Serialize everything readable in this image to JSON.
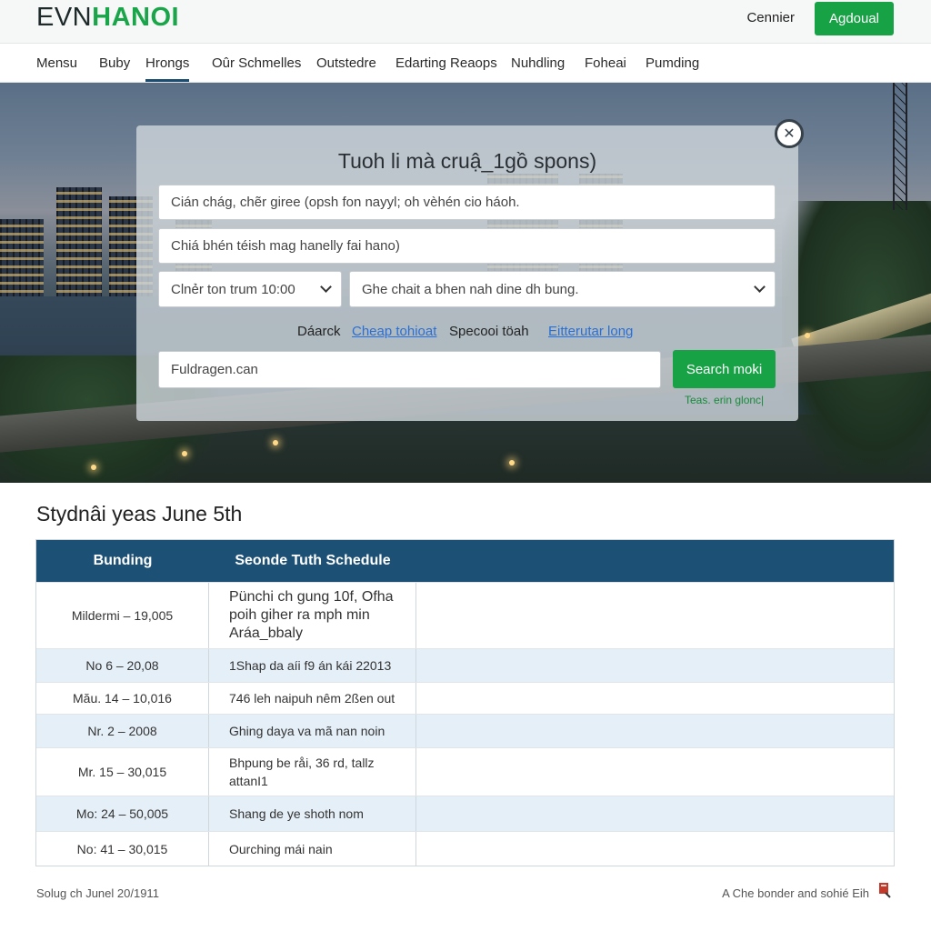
{
  "header": {
    "logo_part1": "EVN",
    "logo_part2": "HANOI",
    "signin_label": "Cennier",
    "primary_button_label": "Agdoual"
  },
  "nav": {
    "items": [
      {
        "label": "Mensu"
      },
      {
        "label": "Buby"
      },
      {
        "label": "Hrongs"
      },
      {
        "label": "Oûr Schmelles"
      },
      {
        "label": "Outstedre"
      },
      {
        "label": "Edarting Reaops"
      },
      {
        "label": "Nuhdling"
      },
      {
        "label": "Foheai"
      },
      {
        "label": "Pumding"
      }
    ],
    "active_index": 2
  },
  "search_panel": {
    "title": "Tuoh li mà cruậ_1gồ spons)",
    "field1_placeholder": "Cián chág, chẽr giree (opsh fon nayyl; oh vèhén cio háoh.",
    "field2_placeholder": "Chiá bhén téish mag hanelly fai hano)",
    "select1_value": "Clnẻr ton trum 10:00",
    "select2_value": "Ghe chait a bhen nah dine dh bung.",
    "quick_links": [
      {
        "label": "Dáarck",
        "is_link": false
      },
      {
        "label": "Cheap tohioat",
        "is_link": true
      },
      {
        "label": "Specooi töah",
        "is_link": false
      },
      {
        "label": "Eitterutar long",
        "is_link": true
      }
    ],
    "search_input_placeholder": "Fuldragen.can",
    "search_button_label": "Search moki",
    "small_link": "Teas. erin glonc|"
  },
  "schedule": {
    "title": "Stydnâi yeas June 5th",
    "columns": [
      "Bunding",
      "Seonde Tuth Schedule"
    ],
    "rows": [
      {
        "date": "Mildermi – 19,005",
        "detail": "Pünchi ch gung 10f, Ofha poih giher ra mph min Aráa_bbaly"
      },
      {
        "date": "No  6  – 20,08",
        "detail": "1Shap da aíi f9 án kái 22013"
      },
      {
        "date": "Mău. 14  – 10,016",
        "detail": "746 leh naipuh nêm 2ßen out"
      },
      {
        "date": "Nr.  2  – 2008",
        "detail": "Ghing daya va mã nan noin"
      },
      {
        "date": "Mr. 15 – 30,015",
        "detail": "Bhpung be råi, 36 rd, tallz attanI1"
      },
      {
        "date": "Mo: 24 – 50,005",
        "detail": "Shang de ye shoth nom"
      },
      {
        "date": "No: 41 – 30,015",
        "detail": "Ourching mái nain"
      }
    ]
  },
  "footer": {
    "left": "Solug ch Junel 20/1911",
    "right": "A Che bonder and sohié Eih"
  },
  "colors": {
    "brand_green": "#17a245",
    "table_header": "#1c5075",
    "row_alt": "#e5eff7",
    "link_blue": "#2a6fd6"
  }
}
